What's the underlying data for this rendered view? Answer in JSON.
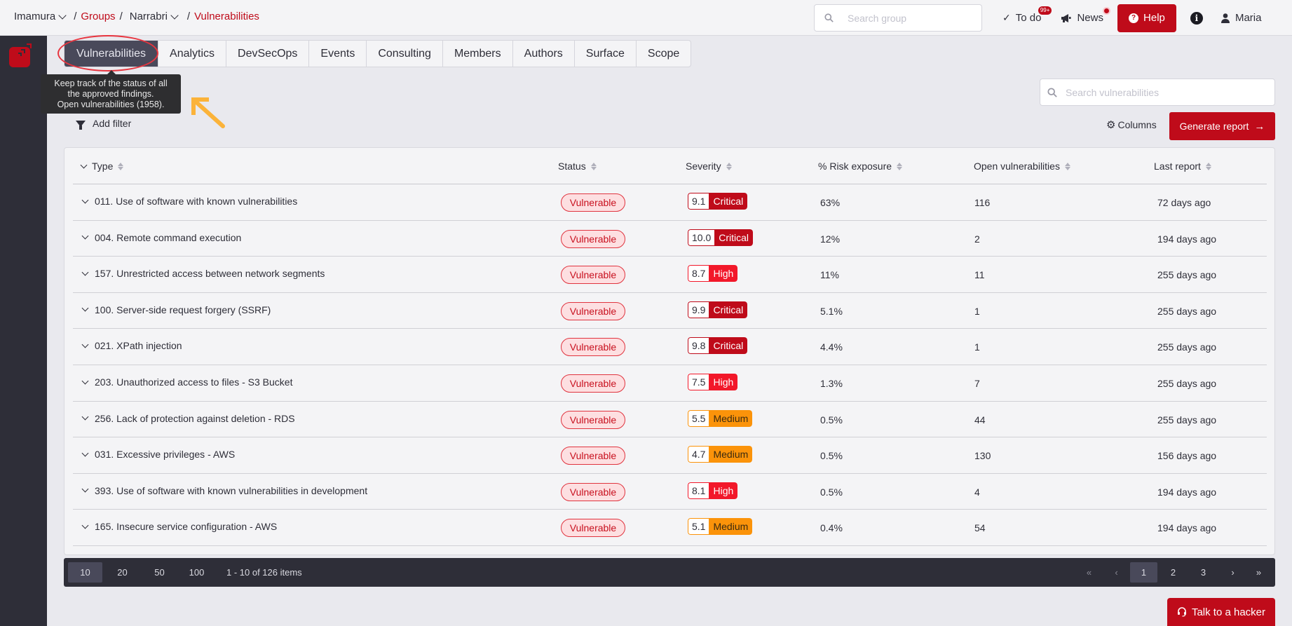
{
  "breadcrumb": {
    "org": "Imamura",
    "groups": "Groups",
    "group": "Narrabri",
    "current": "Vulnerabilities"
  },
  "topbar": {
    "search_placeholder": "Search group",
    "todo_label": "To do",
    "todo_badge": "99+",
    "news_label": "News",
    "help_label": "Help",
    "user_name": "Maria"
  },
  "tabs": [
    {
      "label": "Vulnerabilities",
      "active": true
    },
    {
      "label": "Analytics"
    },
    {
      "label": "DevSecOps"
    },
    {
      "label": "Events"
    },
    {
      "label": "Consulting"
    },
    {
      "label": "Members"
    },
    {
      "label": "Authors"
    },
    {
      "label": "Surface"
    },
    {
      "label": "Scope"
    }
  ],
  "tooltip": {
    "line1": "Keep track of the status of all",
    "line2": "the approved findings.",
    "line3": "Open vulnerabilities (1958)."
  },
  "toolbar": {
    "add_filter": "Add filter",
    "search_placeholder": "Search vulnerabilities",
    "columns": "Columns",
    "generate_report": "Generate report"
  },
  "table": {
    "headers": {
      "type": "Type",
      "status": "Status",
      "severity": "Severity",
      "risk": "% Risk exposure",
      "open": "Open vulnerabilities",
      "last": "Last report"
    },
    "rows": [
      {
        "type": "011. Use of software with known vulnerabilities",
        "status": "Vulnerable",
        "score": "9.1",
        "level": "Critical",
        "risk": "63%",
        "open": "116",
        "last": "72 days ago"
      },
      {
        "type": "004. Remote command execution",
        "status": "Vulnerable",
        "score": "10.0",
        "level": "Critical",
        "risk": "12%",
        "open": "2",
        "last": "194 days ago"
      },
      {
        "type": "157. Unrestricted access between network segments",
        "status": "Vulnerable",
        "score": "8.7",
        "level": "High",
        "risk": "11%",
        "open": "11",
        "last": "255 days ago"
      },
      {
        "type": "100. Server-side request forgery (SSRF)",
        "status": "Vulnerable",
        "score": "9.9",
        "level": "Critical",
        "risk": "5.1%",
        "open": "1",
        "last": "255 days ago"
      },
      {
        "type": "021. XPath injection",
        "status": "Vulnerable",
        "score": "9.8",
        "level": "Critical",
        "risk": "4.4%",
        "open": "1",
        "last": "255 days ago"
      },
      {
        "type": "203. Unauthorized access to files - S3 Bucket",
        "status": "Vulnerable",
        "score": "7.5",
        "level": "High",
        "risk": "1.3%",
        "open": "7",
        "last": "255 days ago"
      },
      {
        "type": "256. Lack of protection against deletion - RDS",
        "status": "Vulnerable",
        "score": "5.5",
        "level": "Medium",
        "risk": "0.5%",
        "open": "44",
        "last": "255 days ago"
      },
      {
        "type": "031. Excessive privileges - AWS",
        "status": "Vulnerable",
        "score": "4.7",
        "level": "Medium",
        "risk": "0.5%",
        "open": "130",
        "last": "156 days ago"
      },
      {
        "type": "393. Use of software with known vulnerabilities in development",
        "status": "Vulnerable",
        "score": "8.1",
        "level": "High",
        "risk": "0.5%",
        "open": "4",
        "last": "194 days ago"
      },
      {
        "type": "165. Insecure service configuration - AWS",
        "status": "Vulnerable",
        "score": "5.1",
        "level": "Medium",
        "risk": "0.4%",
        "open": "54",
        "last": "194 days ago"
      }
    ]
  },
  "severity_colors": {
    "Critical": "#bf0b1a",
    "High": "#f2182a",
    "Medium": "#fb930a"
  },
  "pagination": {
    "sizes": [
      "10",
      "20",
      "50",
      "100"
    ],
    "active_size": "10",
    "info": "1 - 10 of 126 items",
    "pages": [
      "1",
      "2",
      "3"
    ],
    "current_page": "1"
  },
  "talk_to_hacker": "Talk to a hacker",
  "colors": {
    "brand_red": "#bf0b1a",
    "sidebar": "#2e2e38",
    "annotation_ellipse": "#e8353f",
    "annotation_arrow": "#fbb33a"
  }
}
